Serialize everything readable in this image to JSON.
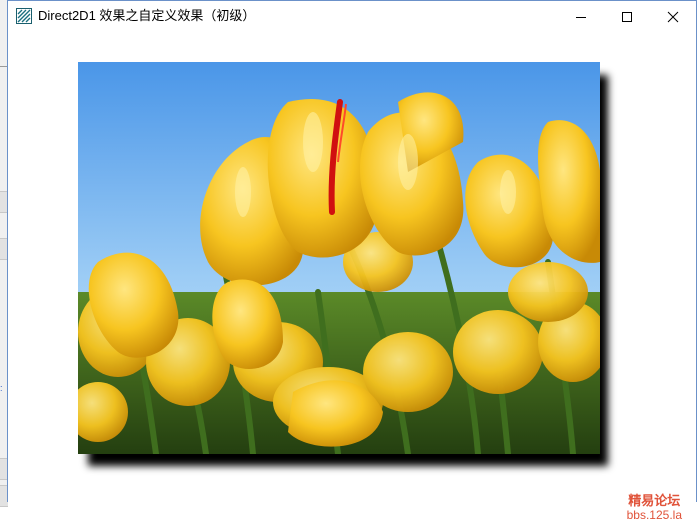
{
  "window": {
    "title": "Direct2D1 效果之自定义效果（初级）",
    "icon": "app-icon"
  },
  "controls": {
    "minimize": "minimize-icon",
    "maximize": "maximize-icon",
    "close": "close-icon"
  },
  "content": {
    "image_subject": "yellow tulips against blue sky",
    "effect": "drop shadow"
  },
  "watermark": {
    "line1": "精易论坛",
    "line2": "bbs.125.la"
  },
  "colors": {
    "window_border": "#6b91c9",
    "sky_top": "#4a96e8",
    "sky_bottom": "#cfe6fb",
    "tulip": "#f5c71e",
    "stem": "#3f6e1e",
    "watermark": "#e0533a"
  }
}
